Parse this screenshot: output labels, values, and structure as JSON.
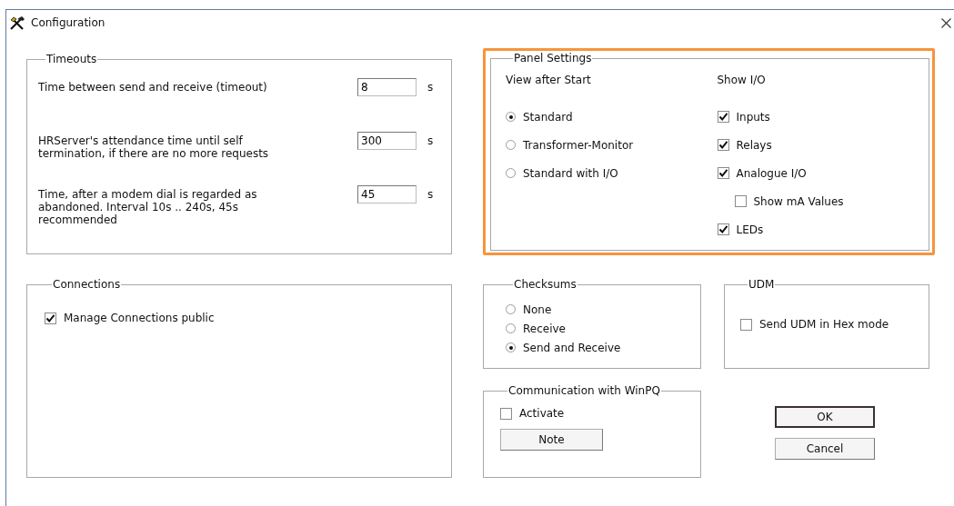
{
  "window": {
    "title": "Configuration"
  },
  "timeouts": {
    "title": "Timeouts",
    "rows": [
      {
        "label": "Time between send and receive (timeout)",
        "value": "8",
        "unit": "s"
      },
      {
        "label": "HRServer's attendance time until self\ntermination, if there are no more requests",
        "value": "300",
        "unit": "s"
      },
      {
        "label": "Time, after a modem dial is regarded as\nabandoned. Interval 10s .. 240s, 45s\nrecommended",
        "value": "45",
        "unit": "s"
      }
    ]
  },
  "panel_settings": {
    "title": "Panel Settings",
    "highlighted": true,
    "view_after_start": {
      "label": "View after Start",
      "options": [
        {
          "label": "Standard",
          "selected": true
        },
        {
          "label": "Transformer-Monitor",
          "selected": false
        },
        {
          "label": "Standard with I/O",
          "selected": false
        }
      ]
    },
    "show_io": {
      "label": "Show I/O",
      "items": [
        {
          "label": "Inputs",
          "checked": true
        },
        {
          "label": "Relays",
          "checked": true
        },
        {
          "label": "Analogue I/O",
          "checked": true,
          "children": [
            {
              "label": "Show mA Values",
              "checked": false
            }
          ]
        },
        {
          "label": "LEDs",
          "checked": true
        }
      ]
    }
  },
  "connections": {
    "title": "Connections",
    "items": [
      {
        "label": "Manage Connections public",
        "checked": true
      }
    ]
  },
  "checksums": {
    "title": "Checksums",
    "options": [
      {
        "label": "None",
        "selected": false
      },
      {
        "label": "Receive",
        "selected": false
      },
      {
        "label": "Send and Receive",
        "selected": true
      }
    ]
  },
  "udm": {
    "title": "UDM",
    "items": [
      {
        "label": "Send UDM in Hex mode",
        "checked": false
      }
    ]
  },
  "communication": {
    "title": "Communication with WinPQ",
    "items": [
      {
        "label": "Activate",
        "checked": false
      }
    ],
    "button": "Note"
  },
  "buttons": [
    {
      "label": "OK",
      "default": true
    },
    {
      "label": "Cancel",
      "default": false
    }
  ]
}
